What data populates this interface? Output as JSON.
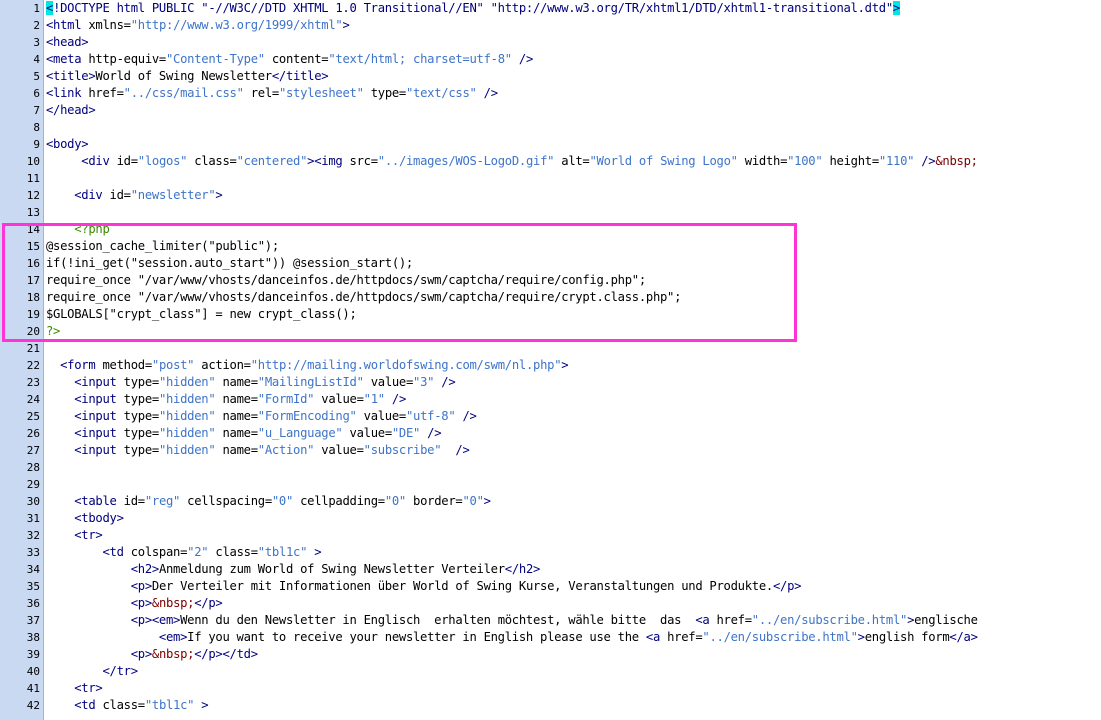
{
  "editor": {
    "highlight_color": "#ff33d6",
    "highlighted_lines": [
      14,
      20
    ],
    "lines": [
      {
        "n": "1",
        "tokens": [
          {
            "c": "t hl",
            "s": "<"
          },
          {
            "c": "t",
            "s": "!DOCTYPE html PUBLIC \"-//W3C//DTD XHTML 1.0 Transitional//EN\" \"http://www.w3.org/TR/xhtml1/DTD/xhtml1-transitional.dtd\""
          },
          {
            "c": "t hl",
            "s": ">"
          }
        ]
      },
      {
        "n": "2",
        "tokens": [
          {
            "c": "t",
            "s": "<html "
          },
          {
            "c": "a",
            "s": "xmlns="
          },
          {
            "c": "v",
            "s": "\"http://www.w3.org/1999/xhtml\""
          },
          {
            "c": "t",
            "s": ">"
          }
        ]
      },
      {
        "n": "3",
        "tokens": [
          {
            "c": "t",
            "s": "<head>"
          }
        ]
      },
      {
        "n": "4",
        "tokens": [
          {
            "c": "t",
            "s": "<meta "
          },
          {
            "c": "a",
            "s": "http-equiv="
          },
          {
            "c": "v",
            "s": "\"Content-Type\""
          },
          {
            "c": "a",
            "s": " content="
          },
          {
            "c": "v",
            "s": "\"text/html; charset=utf-8\""
          },
          {
            "c": "t",
            "s": " />"
          }
        ]
      },
      {
        "n": "5",
        "tokens": [
          {
            "c": "t",
            "s": "<title>"
          },
          {
            "c": "p",
            "s": "World of Swing Newsletter"
          },
          {
            "c": "t",
            "s": "</title>"
          }
        ]
      },
      {
        "n": "6",
        "tokens": [
          {
            "c": "t",
            "s": "<link "
          },
          {
            "c": "a",
            "s": "href="
          },
          {
            "c": "v",
            "s": "\"../css/mail.css\""
          },
          {
            "c": "a",
            "s": " rel="
          },
          {
            "c": "v",
            "s": "\"stylesheet\""
          },
          {
            "c": "a",
            "s": " type="
          },
          {
            "c": "v",
            "s": "\"text/css\""
          },
          {
            "c": "t",
            "s": " />"
          }
        ]
      },
      {
        "n": "7",
        "tokens": [
          {
            "c": "t",
            "s": "</head>"
          }
        ]
      },
      {
        "n": "8",
        "tokens": []
      },
      {
        "n": "9",
        "tokens": [
          {
            "c": "t",
            "s": "<body>"
          }
        ]
      },
      {
        "n": "10",
        "tokens": [
          {
            "c": "p",
            "s": "     "
          },
          {
            "c": "t",
            "s": "<div "
          },
          {
            "c": "a",
            "s": "id="
          },
          {
            "c": "v",
            "s": "\"logos\""
          },
          {
            "c": "a",
            "s": " class="
          },
          {
            "c": "v",
            "s": "\"centered\""
          },
          {
            "c": "t",
            "s": "><img "
          },
          {
            "c": "a",
            "s": "src="
          },
          {
            "c": "v",
            "s": "\"../images/WOS-LogoD.gif\""
          },
          {
            "c": "a",
            "s": " alt="
          },
          {
            "c": "v",
            "s": "\"World of Swing Logo\""
          },
          {
            "c": "a",
            "s": " width="
          },
          {
            "c": "v",
            "s": "\"100\""
          },
          {
            "c": "a",
            "s": " height="
          },
          {
            "c": "v",
            "s": "\"110\""
          },
          {
            "c": "t",
            "s": " />"
          },
          {
            "c": "e",
            "s": "&nbsp;"
          }
        ]
      },
      {
        "n": "11",
        "tokens": []
      },
      {
        "n": "12",
        "tokens": [
          {
            "c": "p",
            "s": "    "
          },
          {
            "c": "t",
            "s": "<div "
          },
          {
            "c": "a",
            "s": "id="
          },
          {
            "c": "v",
            "s": "\"newsletter\""
          },
          {
            "c": "t",
            "s": ">"
          }
        ]
      },
      {
        "n": "13",
        "tokens": []
      },
      {
        "n": "14",
        "tokens": [
          {
            "c": "p",
            "s": "    "
          },
          {
            "c": "php",
            "s": "<?php"
          }
        ]
      },
      {
        "n": "15",
        "tokens": [
          {
            "c": "p",
            "s": "@session_cache_limiter(\"public\");"
          }
        ]
      },
      {
        "n": "16",
        "tokens": [
          {
            "c": "p",
            "s": "if(!ini_get(\"session.auto_start\")) @session_start();"
          }
        ]
      },
      {
        "n": "17",
        "tokens": [
          {
            "c": "p",
            "s": "require_once \"/var/www/vhosts/danceinfos.de/httpdocs/swm/captcha/require/config.php\";"
          }
        ]
      },
      {
        "n": "18",
        "tokens": [
          {
            "c": "p",
            "s": "require_once \"/var/www/vhosts/danceinfos.de/httpdocs/swm/captcha/require/crypt.class.php\";"
          }
        ]
      },
      {
        "n": "19",
        "tokens": [
          {
            "c": "p",
            "s": "$GLOBALS[\"crypt_class\"] = new crypt_class();"
          }
        ]
      },
      {
        "n": "20",
        "tokens": [
          {
            "c": "php",
            "s": "?>"
          }
        ]
      },
      {
        "n": "21",
        "tokens": []
      },
      {
        "n": "22",
        "tokens": [
          {
            "c": "p",
            "s": "  "
          },
          {
            "c": "t",
            "s": "<form "
          },
          {
            "c": "a",
            "s": "method="
          },
          {
            "c": "v",
            "s": "\"post\""
          },
          {
            "c": "a",
            "s": " action="
          },
          {
            "c": "v",
            "s": "\"http://mailing.worldofswing.com/swm/nl.php\""
          },
          {
            "c": "t",
            "s": ">"
          }
        ]
      },
      {
        "n": "23",
        "tokens": [
          {
            "c": "p",
            "s": "    "
          },
          {
            "c": "t",
            "s": "<input "
          },
          {
            "c": "a",
            "s": "type="
          },
          {
            "c": "v",
            "s": "\"hidden\""
          },
          {
            "c": "a",
            "s": " name="
          },
          {
            "c": "v",
            "s": "\"MailingListId\""
          },
          {
            "c": "a",
            "s": " value="
          },
          {
            "c": "v",
            "s": "\"3\""
          },
          {
            "c": "t",
            "s": " />"
          }
        ]
      },
      {
        "n": "24",
        "tokens": [
          {
            "c": "p",
            "s": "    "
          },
          {
            "c": "t",
            "s": "<input "
          },
          {
            "c": "a",
            "s": "type="
          },
          {
            "c": "v",
            "s": "\"hidden\""
          },
          {
            "c": "a",
            "s": " name="
          },
          {
            "c": "v",
            "s": "\"FormId\""
          },
          {
            "c": "a",
            "s": " value="
          },
          {
            "c": "v",
            "s": "\"1\""
          },
          {
            "c": "t",
            "s": " />"
          }
        ]
      },
      {
        "n": "25",
        "tokens": [
          {
            "c": "p",
            "s": "    "
          },
          {
            "c": "t",
            "s": "<input "
          },
          {
            "c": "a",
            "s": "type="
          },
          {
            "c": "v",
            "s": "\"hidden\""
          },
          {
            "c": "a",
            "s": " name="
          },
          {
            "c": "v",
            "s": "\"FormEncoding\""
          },
          {
            "c": "a",
            "s": " value="
          },
          {
            "c": "v",
            "s": "\"utf-8\""
          },
          {
            "c": "t",
            "s": " />"
          }
        ]
      },
      {
        "n": "26",
        "tokens": [
          {
            "c": "p",
            "s": "    "
          },
          {
            "c": "t",
            "s": "<input "
          },
          {
            "c": "a",
            "s": "type="
          },
          {
            "c": "v",
            "s": "\"hidden\""
          },
          {
            "c": "a",
            "s": " name="
          },
          {
            "c": "v",
            "s": "\"u_Language\""
          },
          {
            "c": "a",
            "s": " value="
          },
          {
            "c": "v",
            "s": "\"DE\""
          },
          {
            "c": "t",
            "s": " />"
          }
        ]
      },
      {
        "n": "27",
        "tokens": [
          {
            "c": "p",
            "s": "    "
          },
          {
            "c": "t",
            "s": "<input "
          },
          {
            "c": "a",
            "s": "type="
          },
          {
            "c": "v",
            "s": "\"hidden\""
          },
          {
            "c": "a",
            "s": " name="
          },
          {
            "c": "v",
            "s": "\"Action\""
          },
          {
            "c": "a",
            "s": " value="
          },
          {
            "c": "v",
            "s": "\"subscribe\""
          },
          {
            "c": "t",
            "s": "  />"
          }
        ]
      },
      {
        "n": "28",
        "tokens": []
      },
      {
        "n": "29",
        "tokens": []
      },
      {
        "n": "30",
        "tokens": [
          {
            "c": "p",
            "s": "    "
          },
          {
            "c": "t",
            "s": "<table "
          },
          {
            "c": "a",
            "s": "id="
          },
          {
            "c": "v",
            "s": "\"reg\""
          },
          {
            "c": "a",
            "s": " cellspacing="
          },
          {
            "c": "v",
            "s": "\"0\""
          },
          {
            "c": "a",
            "s": " cellpadding="
          },
          {
            "c": "v",
            "s": "\"0\""
          },
          {
            "c": "a",
            "s": " border="
          },
          {
            "c": "v",
            "s": "\"0\""
          },
          {
            "c": "t",
            "s": ">"
          }
        ]
      },
      {
        "n": "31",
        "tokens": [
          {
            "c": "p",
            "s": "    "
          },
          {
            "c": "t",
            "s": "<tbody>"
          }
        ]
      },
      {
        "n": "32",
        "tokens": [
          {
            "c": "p",
            "s": "    "
          },
          {
            "c": "t",
            "s": "<tr>"
          }
        ]
      },
      {
        "n": "33",
        "tokens": [
          {
            "c": "p",
            "s": "        "
          },
          {
            "c": "t",
            "s": "<td "
          },
          {
            "c": "a",
            "s": "colspan="
          },
          {
            "c": "v",
            "s": "\"2\""
          },
          {
            "c": "a",
            "s": " class="
          },
          {
            "c": "v",
            "s": "\"tbl1c\""
          },
          {
            "c": "t",
            "s": " >"
          }
        ]
      },
      {
        "n": "34",
        "tokens": [
          {
            "c": "p",
            "s": "            "
          },
          {
            "c": "t",
            "s": "<h2>"
          },
          {
            "c": "p",
            "s": "Anmeldung zum World of Swing Newsletter Verteiler"
          },
          {
            "c": "t",
            "s": "</h2>"
          }
        ]
      },
      {
        "n": "35",
        "tokens": [
          {
            "c": "p",
            "s": "            "
          },
          {
            "c": "t",
            "s": "<p>"
          },
          {
            "c": "p",
            "s": "Der Verteiler mit Informationen über World of Swing Kurse, Veranstaltungen und Produkte."
          },
          {
            "c": "t",
            "s": "</p>"
          }
        ]
      },
      {
        "n": "36",
        "tokens": [
          {
            "c": "p",
            "s": "            "
          },
          {
            "c": "t",
            "s": "<p>"
          },
          {
            "c": "e",
            "s": "&nbsp;"
          },
          {
            "c": "t",
            "s": "</p>"
          }
        ]
      },
      {
        "n": "37",
        "tokens": [
          {
            "c": "p",
            "s": "            "
          },
          {
            "c": "t",
            "s": "<p><em>"
          },
          {
            "c": "p",
            "s": "Wenn du den Newsletter in Englisch  erhalten möchtest, wähle bitte  das  "
          },
          {
            "c": "t",
            "s": "<a "
          },
          {
            "c": "a",
            "s": "href="
          },
          {
            "c": "v",
            "s": "\"../en/subscribe.html\""
          },
          {
            "c": "t",
            "s": ">"
          },
          {
            "c": "p",
            "s": "englische"
          }
        ]
      },
      {
        "n": "38",
        "tokens": [
          {
            "c": "p",
            "s": "                "
          },
          {
            "c": "t",
            "s": "<em>"
          },
          {
            "c": "p",
            "s": "If you want to receive your newsletter in English please use the "
          },
          {
            "c": "t",
            "s": "<a "
          },
          {
            "c": "a",
            "s": "href="
          },
          {
            "c": "v",
            "s": "\"../en/subscribe.html\""
          },
          {
            "c": "t",
            "s": ">"
          },
          {
            "c": "p",
            "s": "english form"
          },
          {
            "c": "t",
            "s": "</a>"
          }
        ]
      },
      {
        "n": "39",
        "tokens": [
          {
            "c": "p",
            "s": "            "
          },
          {
            "c": "t",
            "s": "<p>"
          },
          {
            "c": "e",
            "s": "&nbsp;"
          },
          {
            "c": "t",
            "s": "</p></td>"
          }
        ]
      },
      {
        "n": "40",
        "tokens": [
          {
            "c": "p",
            "s": "        "
          },
          {
            "c": "t",
            "s": "</tr>"
          }
        ]
      },
      {
        "n": "41",
        "tokens": [
          {
            "c": "p",
            "s": "    "
          },
          {
            "c": "t",
            "s": "<tr>"
          }
        ]
      },
      {
        "n": "42",
        "tokens": [
          {
            "c": "p",
            "s": "    "
          },
          {
            "c": "t",
            "s": "<td "
          },
          {
            "c": "a",
            "s": "class="
          },
          {
            "c": "v",
            "s": "\"tbl1c\""
          },
          {
            "c": "t",
            "s": " >"
          }
        ]
      }
    ]
  }
}
